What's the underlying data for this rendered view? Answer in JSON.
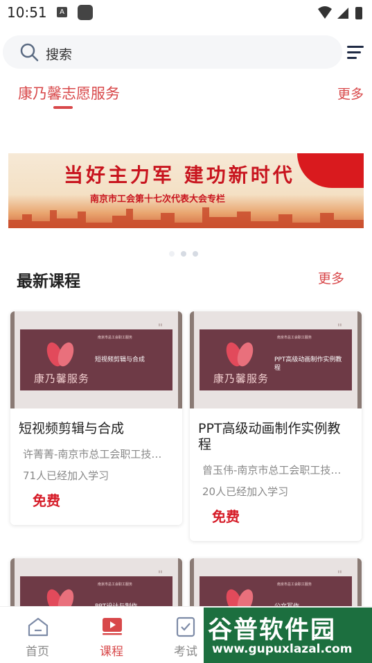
{
  "status_bar": {
    "time": "10:51",
    "a_icon": "A"
  },
  "search": {
    "placeholder": "搜索"
  },
  "volunteer": {
    "title": "康乃馨志愿服务",
    "more": "更多"
  },
  "banner": {
    "line1": "当好主力军 建功新时代",
    "line2": "南京市工会第十七次代表大会专栏"
  },
  "courses": {
    "title": "最新课程",
    "more": "更多",
    "items": [
      {
        "thumb_main": "短视频剪辑与合成",
        "thumb_org": "南京市总工会职工服务",
        "thumb_brand": "康乃馨服务",
        "title": "短视频剪辑与合成",
        "author": "许菁菁-南京市总工会职工技…",
        "count": "71人已经加入学习",
        "price": "免费"
      },
      {
        "thumb_main": "PPT高级动画制作实例教程",
        "thumb_org": "南京市总工会职工服务",
        "thumb_brand": "康乃馨服务",
        "title": "PPT高级动画制作实例教程",
        "author": "曾玉伟-南京市总工会职工技…",
        "count": "20人已经加入学习",
        "price": "免费"
      },
      {
        "thumb_main": "PPT设计与制作",
        "thumb_org": "南京市总工会职工服务"
      },
      {
        "thumb_main": "公文写作",
        "thumb_org": "南京市总工会职工服务"
      }
    ]
  },
  "tabbar": {
    "items": [
      {
        "label": "首页",
        "icon": "home-icon",
        "color": "#888888"
      },
      {
        "label": "课程",
        "icon": "play-icon",
        "color": "#d8484a"
      },
      {
        "label": "考试",
        "icon": "exam-icon",
        "color": "#888888"
      }
    ]
  },
  "watermark": {
    "main": "谷普软件园",
    "url": "www.gupuxlazal.com"
  },
  "colors": {
    "accent": "#d8484a",
    "price": "#d61c28"
  }
}
